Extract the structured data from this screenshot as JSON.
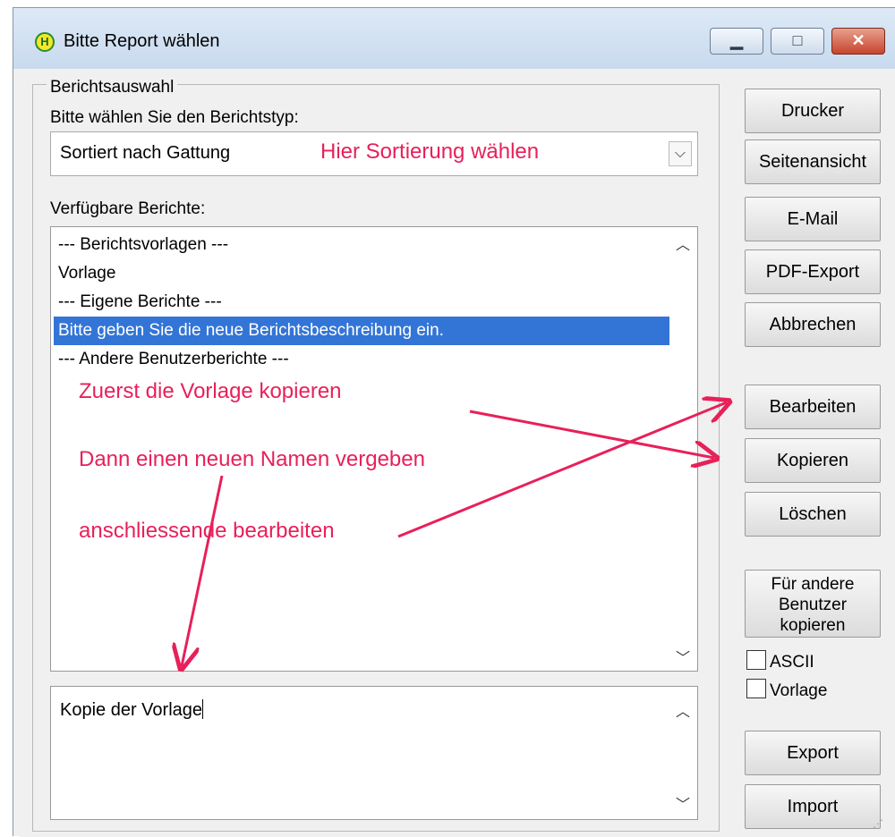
{
  "window": {
    "title": "Bitte Report wählen",
    "icon_letter": "H"
  },
  "group": {
    "label": "Berichtsauswahl"
  },
  "report_type": {
    "label": "Bitte wählen Sie den Berichtstyp:",
    "selected": "Sortiert nach Gattung"
  },
  "reports": {
    "label": "Verfügbare Berichte:",
    "items": [
      "--- Berichtsvorlagen ---",
      "Vorlage",
      "--- Eigene Berichte ---",
      "Bitte geben Sie die neue Berichtsbeschreibung ein.",
      "--- Andere Benutzerberichte ---"
    ],
    "selected_index": 3
  },
  "description": {
    "value": "Kopie der Vorlage"
  },
  "buttons": {
    "drucker": "Drucker",
    "seitenansicht": "Seitenansicht",
    "email": "E-Mail",
    "pdf_export": "PDF-Export",
    "abbrechen": "Abbrechen",
    "bearbeiten": "Bearbeiten",
    "kopieren": "Kopieren",
    "loeschen": "Löschen",
    "andere_benutzer": "Für andere Benutzer kopieren",
    "export": "Export",
    "import": "Import"
  },
  "checkboxes": {
    "ascii": "ASCII",
    "vorlage": "Vorlage"
  },
  "annotations": {
    "sort_hint": "Hier Sortierung wählen",
    "step1": "Zuerst die Vorlage kopieren",
    "step2": "Dann einen neuen Namen vergeben",
    "step3": "anschliessende bearbeiten",
    "color": "#e8205a"
  },
  "colors": {
    "selection": "#3375d6",
    "titlebar": "#c8daee"
  }
}
